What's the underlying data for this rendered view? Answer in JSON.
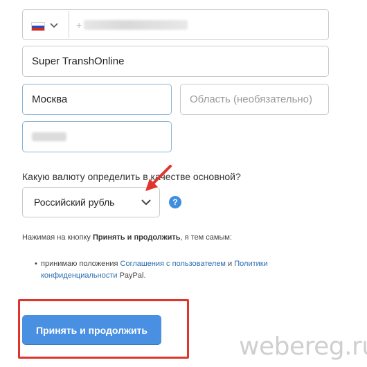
{
  "phone": {
    "country": "Russia",
    "prefix": "+"
  },
  "company": {
    "value": "Super TranshOnline"
  },
  "city": {
    "value": "Москва"
  },
  "region": {
    "placeholder": "Область (необязательно)"
  },
  "currency": {
    "question": "Какую валюту определить в качестве основной?",
    "selected": "Российский рубль",
    "help_symbol": "?"
  },
  "consent": {
    "prefix": "Нажимая на кнопку ",
    "button_ref": "Принять и продолжить",
    "suffix": ", я тем самым:",
    "item_text_1": "принимаю положения ",
    "link_user_agreement": "Соглашения с пользователем",
    "item_and": " и ",
    "link_policy_1": "Политики",
    "link_policy_2": "конфиденциальности",
    "item_end": " PayPal."
  },
  "accept_button": {
    "label": "Принять и продолжить"
  },
  "watermark": "webereg.ru",
  "colors": {
    "primary_button": "#4a90e2",
    "highlight": "#e0342c",
    "link": "#2b6cb0",
    "arrow": "#e0342c"
  }
}
